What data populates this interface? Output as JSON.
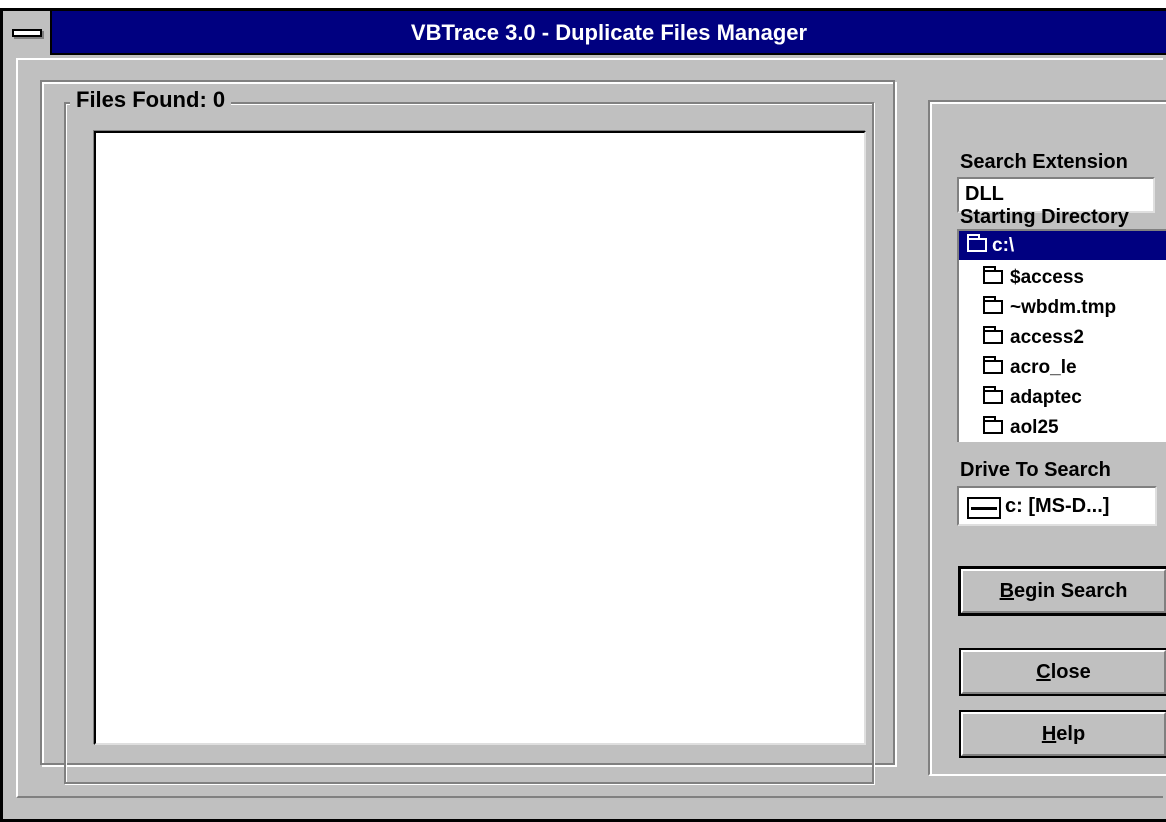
{
  "window": {
    "title": "VBTrace 3.0  -  Duplicate Files Manager"
  },
  "files_group": {
    "title": "Files Found: 0",
    "items": []
  },
  "search_extension": {
    "label": "Search Extension",
    "value": "DLL"
  },
  "starting_directory": {
    "label": "Starting Directory",
    "items": [
      {
        "label": "c:\\",
        "icon": "open-folder-icon",
        "selected": true
      },
      {
        "label": "$access",
        "icon": "folder-icon"
      },
      {
        "label": "~wbdm.tmp",
        "icon": "folder-icon"
      },
      {
        "label": "access2",
        "icon": "folder-icon"
      },
      {
        "label": "acro_le",
        "icon": "folder-icon"
      },
      {
        "label": "adaptec",
        "icon": "folder-icon"
      },
      {
        "label": "aol25",
        "icon": "folder-icon"
      }
    ]
  },
  "drive": {
    "label": "Drive To Search",
    "value": "c: [MS-D...]",
    "icon": "drive-icon"
  },
  "buttons": {
    "begin_search": {
      "mnemonic": "B",
      "rest": "egin Search"
    },
    "close": {
      "mnemonic": "C",
      "rest": "lose"
    },
    "help": {
      "mnemonic": "H",
      "rest": "elp"
    }
  },
  "colors": {
    "face": "#c0c0c0",
    "titlebar": "#000080",
    "selection": "#000080",
    "window_bg": "#ffffff"
  }
}
